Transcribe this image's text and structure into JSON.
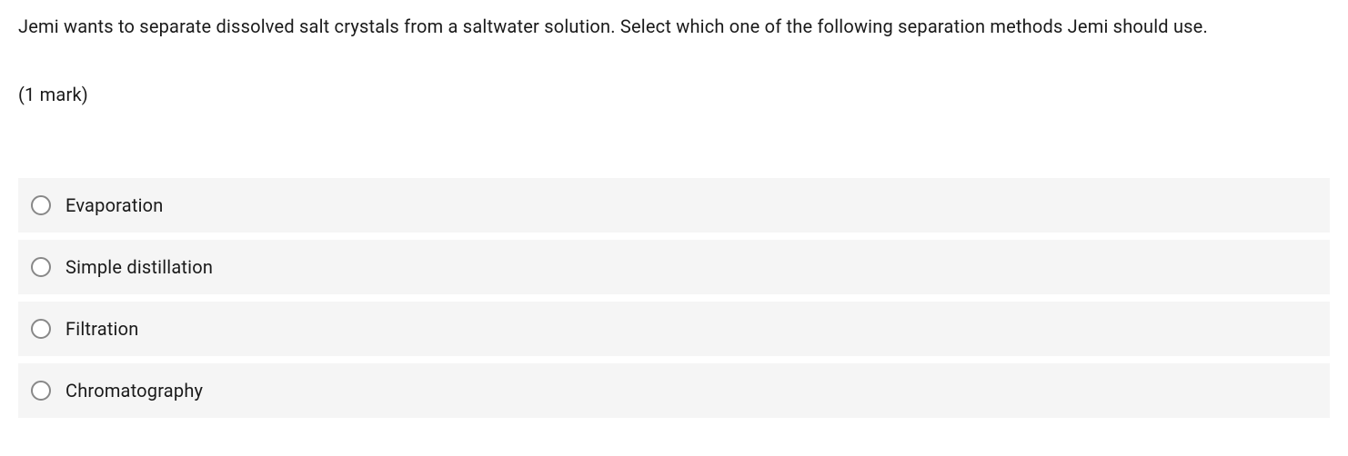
{
  "question": {
    "text": "Jemi wants to separate dissolved salt crystals from a saltwater solution. Select which one of the following separation methods Jemi should use.",
    "marks": "(1 mark)"
  },
  "options": [
    {
      "label": "Evaporation"
    },
    {
      "label": "Simple distillation"
    },
    {
      "label": "Filtration"
    },
    {
      "label": "Chromatography"
    }
  ]
}
